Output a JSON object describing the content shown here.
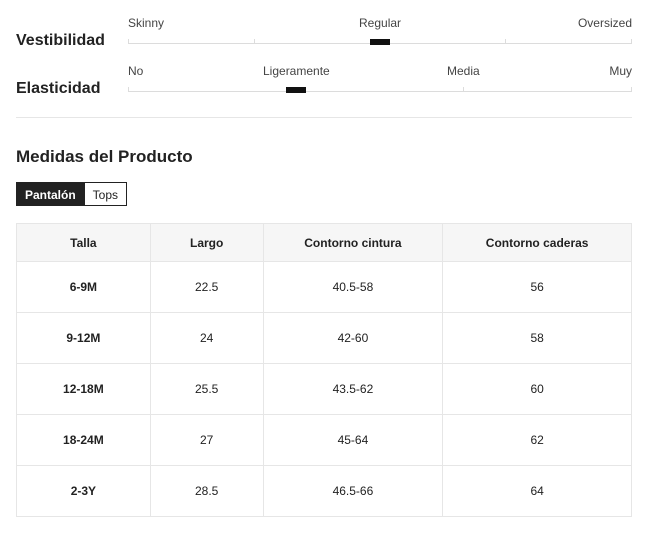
{
  "fit": {
    "title": "Vestibilidad",
    "labels": [
      "Skinny",
      "Regular",
      "Oversized"
    ],
    "value": "Regular"
  },
  "elasticity": {
    "title": "Elasticidad",
    "labels": [
      "No",
      "Ligeramente",
      "Media",
      "Muy"
    ],
    "value": "Ligeramente"
  },
  "measurements": {
    "title": "Medidas del Producto",
    "tabs": [
      "Pantalón",
      "Tops"
    ],
    "active_tab": "Pantalón",
    "columns": [
      "Talla",
      "Largo",
      "Contorno cintura",
      "Contorno caderas"
    ],
    "rows": [
      [
        "6-9M",
        "22.5",
        "40.5-58",
        "56"
      ],
      [
        "9-12M",
        "24",
        "42-60",
        "58"
      ],
      [
        "12-18M",
        "25.5",
        "43.5-62",
        "60"
      ],
      [
        "18-24M",
        "27",
        "45-64",
        "62"
      ],
      [
        "2-3Y",
        "28.5",
        "46.5-66",
        "64"
      ]
    ]
  }
}
